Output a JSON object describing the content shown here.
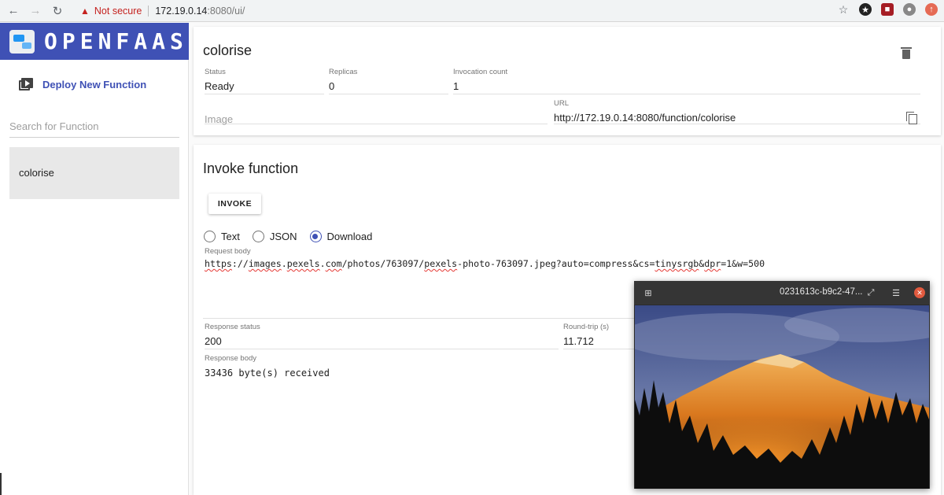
{
  "browser": {
    "not_secure": "Not secure",
    "url_host": "172.19.0.14",
    "url_rest": ":8080/ui/"
  },
  "sidebar": {
    "logo_text": "OPENFAAS",
    "deploy_label": "Deploy New Function",
    "search_placeholder": "Search for Function",
    "functions": [
      "colorise"
    ]
  },
  "function": {
    "name": "colorise",
    "status_label": "Status",
    "status": "Ready",
    "replicas_label": "Replicas",
    "replicas": "0",
    "invocation_label": "Invocation count",
    "invocation_count": "1",
    "image_placeholder": "Image",
    "url_label": "URL",
    "url": "http://172.19.0.14:8080/function/colorise"
  },
  "invoke": {
    "title": "Invoke function",
    "button": "INVOKE",
    "options": [
      "Text",
      "JSON",
      "Download"
    ],
    "selected": "Download",
    "request_label": "Request body",
    "request_body": {
      "p1": "https",
      "p2": "://",
      "p3": "images",
      "p4": ".",
      "p5": "pexels",
      "p6": ".",
      "p7": "com",
      "p8": "/photos/763097/",
      "p9": "pexels",
      "p10": "-photo-763097.jpeg?auto=compress&cs=",
      "p11": "tinysrgb",
      "p12": "&",
      "p13": "dpr",
      "p14": "=1&w=500"
    },
    "response_status_label": "Response status",
    "response_status": "200",
    "roundtrip_label": "Round-trip (s)",
    "roundtrip": "11.712",
    "response_body_label": "Response body",
    "response_body": "33436 byte(s) received"
  },
  "viewer": {
    "title": "0231613c-b9c2-47..."
  },
  "colors": {
    "brand": "#3f51b5",
    "selected_item": "#e8e8e8"
  }
}
